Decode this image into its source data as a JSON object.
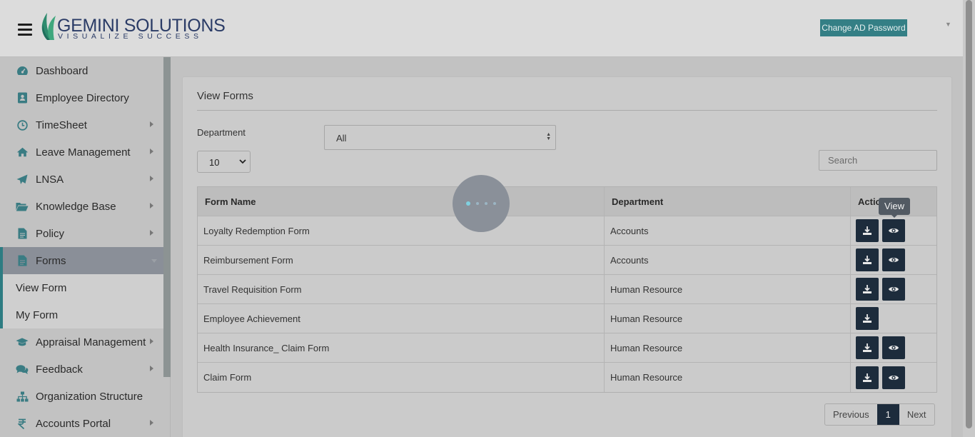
{
  "brand": {
    "name": "GEMINI SOLUTIONS",
    "tagline": "VISUALIZE SUCCESS"
  },
  "header": {
    "change_password_label": "Change AD Password",
    "user_menu_icon": "chevron-down-icon"
  },
  "sidebar": {
    "items": [
      {
        "label": "Dashboard",
        "icon": "dashboard-icon",
        "has_submenu": false
      },
      {
        "label": "Employee Directory",
        "icon": "address-book-icon",
        "has_submenu": false
      },
      {
        "label": "TimeSheet",
        "icon": "clock-icon",
        "has_submenu": true
      },
      {
        "label": "Leave Management",
        "icon": "home-icon",
        "has_submenu": true
      },
      {
        "label": "LNSA",
        "icon": "paper-plane-icon",
        "has_submenu": true
      },
      {
        "label": "Knowledge Base",
        "icon": "folder-open-icon",
        "has_submenu": true
      },
      {
        "label": "Policy",
        "icon": "document-icon",
        "has_submenu": true
      },
      {
        "label": "Forms",
        "icon": "document-icon",
        "has_submenu": true,
        "active": true
      },
      {
        "label": "Appraisal Management",
        "icon": "graduation-cap-icon",
        "has_submenu": true
      },
      {
        "label": "Feedback",
        "icon": "comments-icon",
        "has_submenu": true
      },
      {
        "label": "Organization Structure",
        "icon": "sitemap-icon",
        "has_submenu": false
      },
      {
        "label": "Accounts Portal",
        "icon": "rupee-icon",
        "has_submenu": true
      }
    ],
    "forms_submenu": [
      "View Form",
      "My Form"
    ]
  },
  "main": {
    "title": "View Forms",
    "department_label": "Department",
    "department_value": "All",
    "page_length_value": "10",
    "search_placeholder": "Search",
    "table": {
      "columns": [
        "Form Name",
        "Department",
        "Action"
      ],
      "rows": [
        {
          "name": "Loyalty Redemption Form",
          "department": "Accounts",
          "has_view": true
        },
        {
          "name": "Reimbursement Form",
          "department": "Accounts",
          "has_view": true
        },
        {
          "name": "Travel Requisition Form",
          "department": "Human Resource",
          "has_view": true
        },
        {
          "name": "Employee Achievement",
          "department": "Human Resource",
          "has_view": false
        },
        {
          "name": "Health Insurance_ Claim Form",
          "department": "Human Resource",
          "has_view": true
        },
        {
          "name": "Claim Form",
          "department": "Human Resource",
          "has_view": true
        }
      ]
    },
    "tooltip": "View",
    "pagination": {
      "previous": "Previous",
      "current": "1",
      "next": "Next"
    }
  },
  "colors": {
    "accent": "#347f85",
    "dark_button": "#1d2c3c",
    "overlay": "#c2c2c2"
  }
}
